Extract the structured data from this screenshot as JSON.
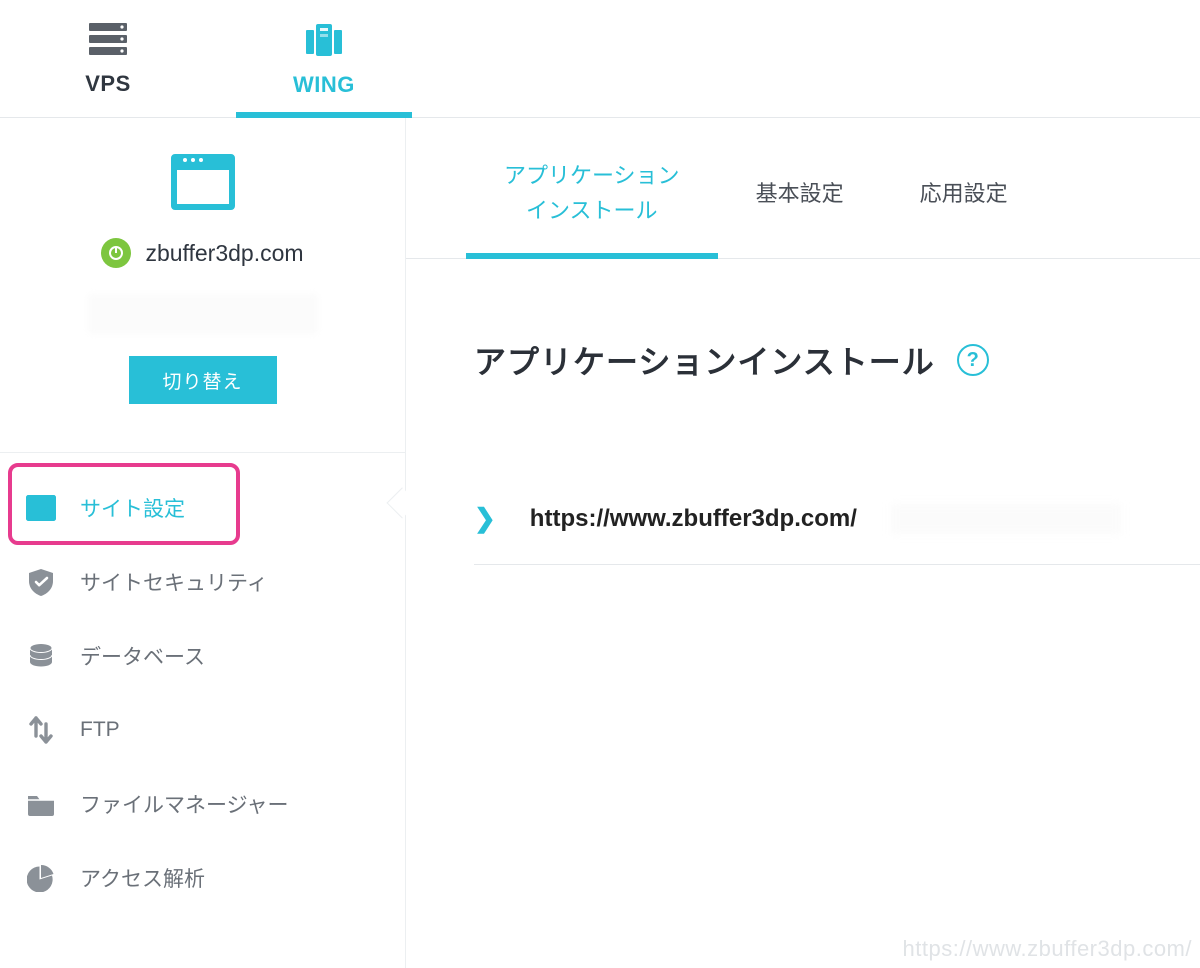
{
  "top_tabs": [
    {
      "label": "VPS",
      "active": false
    },
    {
      "label": "WING",
      "active": true
    }
  ],
  "site": {
    "domain": "zbuffer3dp.com",
    "switch_btn": "切り替え"
  },
  "nav": [
    {
      "label": "サイト設定",
      "active": true
    },
    {
      "label": "サイトセキュリティ",
      "active": false
    },
    {
      "label": "データベース",
      "active": false
    },
    {
      "label": "FTP",
      "active": false
    },
    {
      "label": "ファイルマネージャー",
      "active": false
    },
    {
      "label": "アクセス解析",
      "active": false
    }
  ],
  "sub_tabs": [
    {
      "label": "アプリケーション\nインストール",
      "active": true
    },
    {
      "label": "基本設定",
      "active": false
    },
    {
      "label": "応用設定",
      "active": false
    }
  ],
  "page_title": "アプリケーションインストール",
  "help_symbol": "?",
  "install_item": {
    "caret": "❯",
    "url": "https://www.zbuffer3dp.com/"
  },
  "watermark": "https://www.zbuffer3dp.com/"
}
